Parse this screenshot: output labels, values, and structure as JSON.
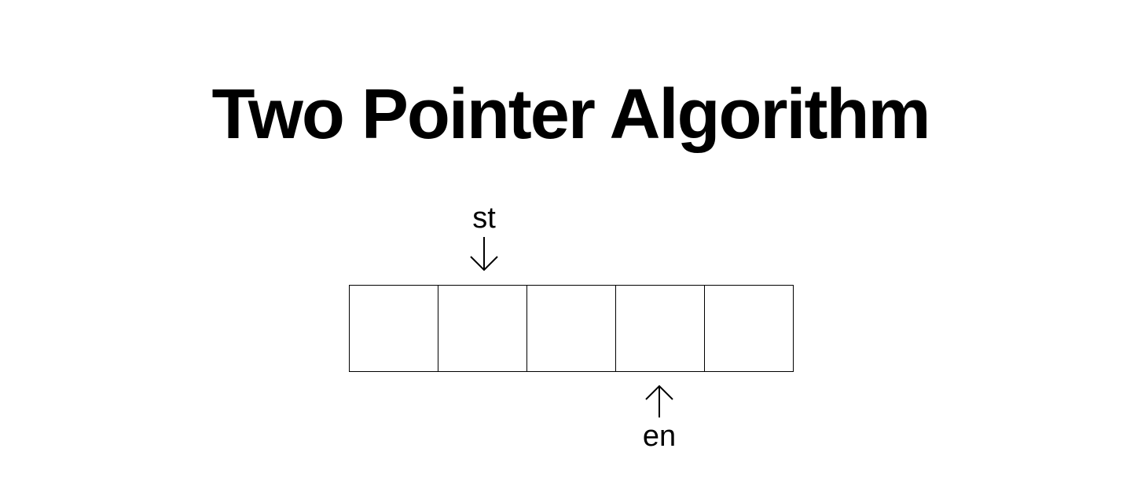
{
  "title": "Two Pointer Algorithm",
  "array": {
    "cells": [
      "",
      "",
      "",
      "",
      ""
    ]
  },
  "pointers": {
    "start": {
      "label": "st",
      "index": 1,
      "direction": "down"
    },
    "end": {
      "label": "en",
      "index": 3,
      "direction": "up"
    }
  }
}
